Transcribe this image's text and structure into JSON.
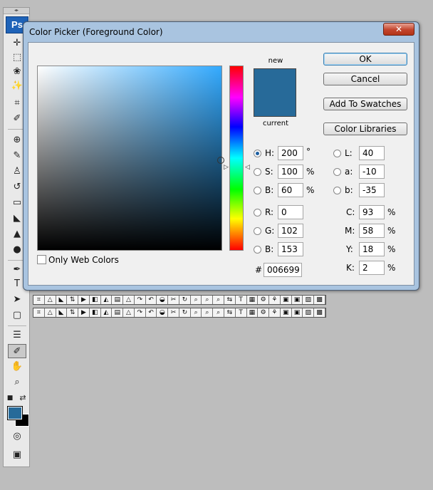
{
  "toolbox": {
    "logo": "Ps",
    "grip": "◂▸",
    "tools": [
      {
        "name": "move-tool",
        "glyph": "✛"
      },
      {
        "name": "marquee-tool",
        "glyph": "⬚"
      },
      {
        "name": "lasso-tool",
        "glyph": "❀"
      },
      {
        "name": "magic-wand-tool",
        "glyph": "✨"
      },
      {
        "name": "crop-tool",
        "glyph": "⌗"
      },
      {
        "name": "eyedropper-tool",
        "glyph": "✐"
      },
      {
        "name": "healing-brush-tool",
        "glyph": "⊕"
      },
      {
        "name": "brush-tool",
        "glyph": "✎"
      },
      {
        "name": "clone-stamp-tool",
        "glyph": "♙"
      },
      {
        "name": "history-brush-tool",
        "glyph": "↺"
      },
      {
        "name": "eraser-tool",
        "glyph": "▭"
      },
      {
        "name": "paint-bucket-tool",
        "glyph": "◣"
      },
      {
        "name": "blur-tool",
        "glyph": "▲"
      },
      {
        "name": "dodge-tool",
        "glyph": "●"
      },
      {
        "name": "pen-tool",
        "glyph": "✒"
      },
      {
        "name": "type-tool",
        "glyph": "T"
      },
      {
        "name": "path-selection-tool",
        "glyph": "➤"
      },
      {
        "name": "shape-tool",
        "glyph": "▢"
      },
      {
        "name": "notes-tool",
        "glyph": "☰"
      },
      {
        "name": "eyedropper-tool-2",
        "glyph": "✐"
      },
      {
        "name": "hand-tool",
        "glyph": "✋"
      },
      {
        "name": "zoom-tool",
        "glyph": "⌕"
      }
    ],
    "default_colors_glyph": "■",
    "swap_colors_glyph": "⇄",
    "quick_mask_glyph": "◎",
    "screen_mode_glyph": "▣"
  },
  "strip_glyphs": [
    "⌗",
    "△",
    "◣",
    "⇅",
    "▶",
    "◧",
    "◭",
    "▤",
    "△",
    "↷",
    "↶",
    "◒",
    "✂",
    "↻",
    "⌕",
    "⌕",
    "⌕",
    "⇆",
    "T",
    "▦",
    "⚙",
    "⚘",
    "▣",
    "▣",
    "▨",
    "▩"
  ],
  "dialog": {
    "title": "Color Picker (Foreground Color)",
    "close_glyph": "✕",
    "new_label": "new",
    "current_label": "current",
    "new_color": "#276a99",
    "current_color": "#276a99",
    "buttons": {
      "ok": "OK",
      "cancel": "Cancel",
      "add_to_swatches": "Add To Swatches",
      "color_libraries": "Color Libraries"
    },
    "only_web_colors": "Only Web Colors",
    "hsb": {
      "h_label": "H:",
      "h_value": "200",
      "h_unit": "°",
      "s_label": "S:",
      "s_value": "100",
      "s_unit": "%",
      "b_label": "B:",
      "b_value": "60",
      "b_unit": "%"
    },
    "rgb": {
      "r_label": "R:",
      "r_value": "0",
      "g_label": "G:",
      "g_value": "102",
      "b_label": "B:",
      "b_value": "153"
    },
    "hex": {
      "label": "#",
      "value": "006699"
    },
    "lab": {
      "l_label": "L:",
      "l_value": "40",
      "a_label": "a:",
      "a_value": "-10",
      "b_label": "b:",
      "b_value": "-35"
    },
    "cmyk": {
      "c_label": "C:",
      "c_value": "93",
      "c_unit": "%",
      "m_label": "M:",
      "m_value": "58",
      "m_unit": "%",
      "y_label": "Y:",
      "y_value": "18",
      "y_unit": "%",
      "k_label": "K:",
      "k_value": "2",
      "k_unit": "%"
    },
    "hue_arrow_left": "▷",
    "hue_arrow_right": "◁"
  }
}
